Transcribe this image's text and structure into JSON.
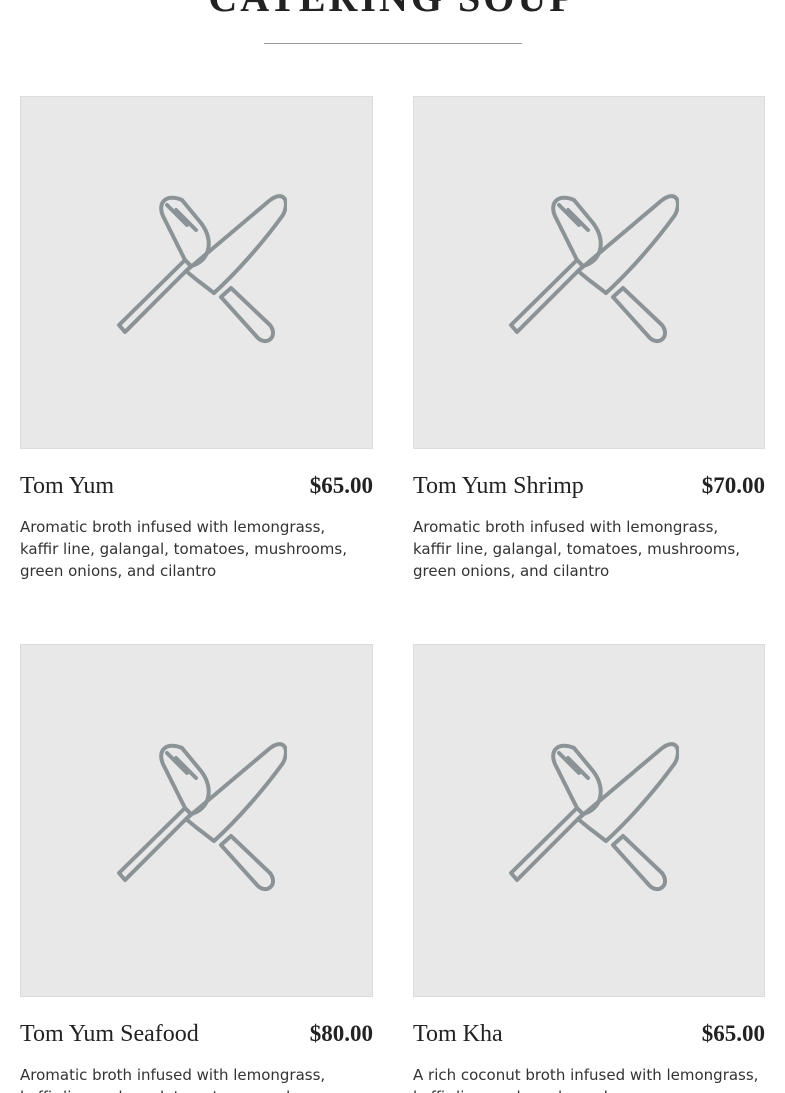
{
  "section": {
    "title": "CATERING SOUP"
  },
  "items": [
    {
      "name": "Tom Yum",
      "price": "$65.00",
      "description": "Aromatic broth infused with lemongrass, kaffir line, galangal, tomatoes, mushrooms, green onions, and cilantro",
      "image_icon": "fork-knife-icon"
    },
    {
      "name": "Tom Yum Shrimp",
      "price": "$70.00",
      "description": "Aromatic broth infused with lemongrass, kaffir line, galangal, tomatoes, mushrooms, green onions, and cilantro",
      "image_icon": "fork-knife-icon"
    },
    {
      "name": "Tom Yum Seafood",
      "price": "$80.00",
      "description": "Aromatic broth infused with lemongrass, kaffir line, galangal, tomatoes, mushrooms, green onions, and cilantro",
      "image_icon": "fork-knife-icon"
    },
    {
      "name": "Tom Kha",
      "price": "$65.00",
      "description": "A rich coconut broth infused with lemongrass, kaffir lime, galangal, mushrooms, green onions, and cilantro",
      "image_icon": "fork-knife-icon"
    }
  ],
  "colors": {
    "placeholder_bg": "#e8e8e8",
    "icon_stroke": "#8c9396",
    "text": "#222222"
  }
}
